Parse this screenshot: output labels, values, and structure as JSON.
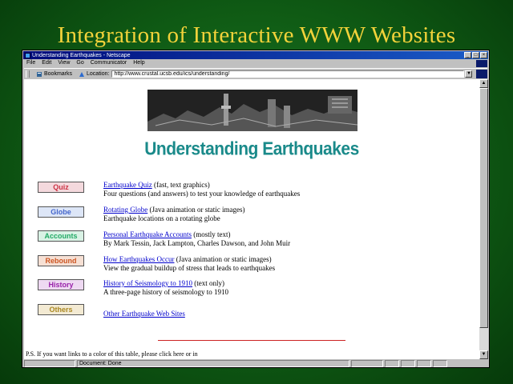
{
  "slide": {
    "title": "Integration of Interactive WWW Websites"
  },
  "window": {
    "title": "Understanding Earthquakes - Netscape",
    "menu": [
      "File",
      "Edit",
      "View",
      "Go",
      "Communicator",
      "Help"
    ],
    "bookmarks_label": "Bookmarks",
    "location_label": "Location:",
    "location_value": "http://www.crustal.ucsb.edu/ics/understanding/"
  },
  "page": {
    "heading": "Understanding Earthquakes",
    "items": [
      {
        "button": "Quiz",
        "link": "Earthquake Quiz",
        "note": " (fast, text graphics)",
        "desc": "Four questions (and answers) to test your knowledge of earthquakes",
        "color": "#cc3344"
      },
      {
        "button": "Globe",
        "link": "Rotating Globe",
        "note": " (Java animation or static images)",
        "desc": "Earthquake locations on a rotating globe",
        "color": "#4466cc"
      },
      {
        "button": "Accounts",
        "link": "Personal Earthquake Accounts",
        "note": " (mostly text)",
        "desc": "By Mark Tessin, Jack Lampton, Charles Dawson, and John Muir",
        "color": "#22aa66"
      },
      {
        "button": "Rebound",
        "link": "How Earthquakes Occur",
        "note": " (Java animation or static images)",
        "desc": "View the gradual buildup of stress that leads to earthquakes",
        "color": "#cc5522"
      },
      {
        "button": "History",
        "link": "History of Seismology to 1910",
        "note": " (text only)",
        "desc": "A three-page history of seismology to 1910",
        "color": "#9922aa"
      },
      {
        "button": "Others",
        "link": "Other Earthquake Web Sites",
        "note": "",
        "desc": "",
        "color": "#aa8822"
      }
    ],
    "footnote": "P.S. If you want links to a color of this table, please click here or in"
  },
  "status": {
    "text": "Document: Done"
  }
}
